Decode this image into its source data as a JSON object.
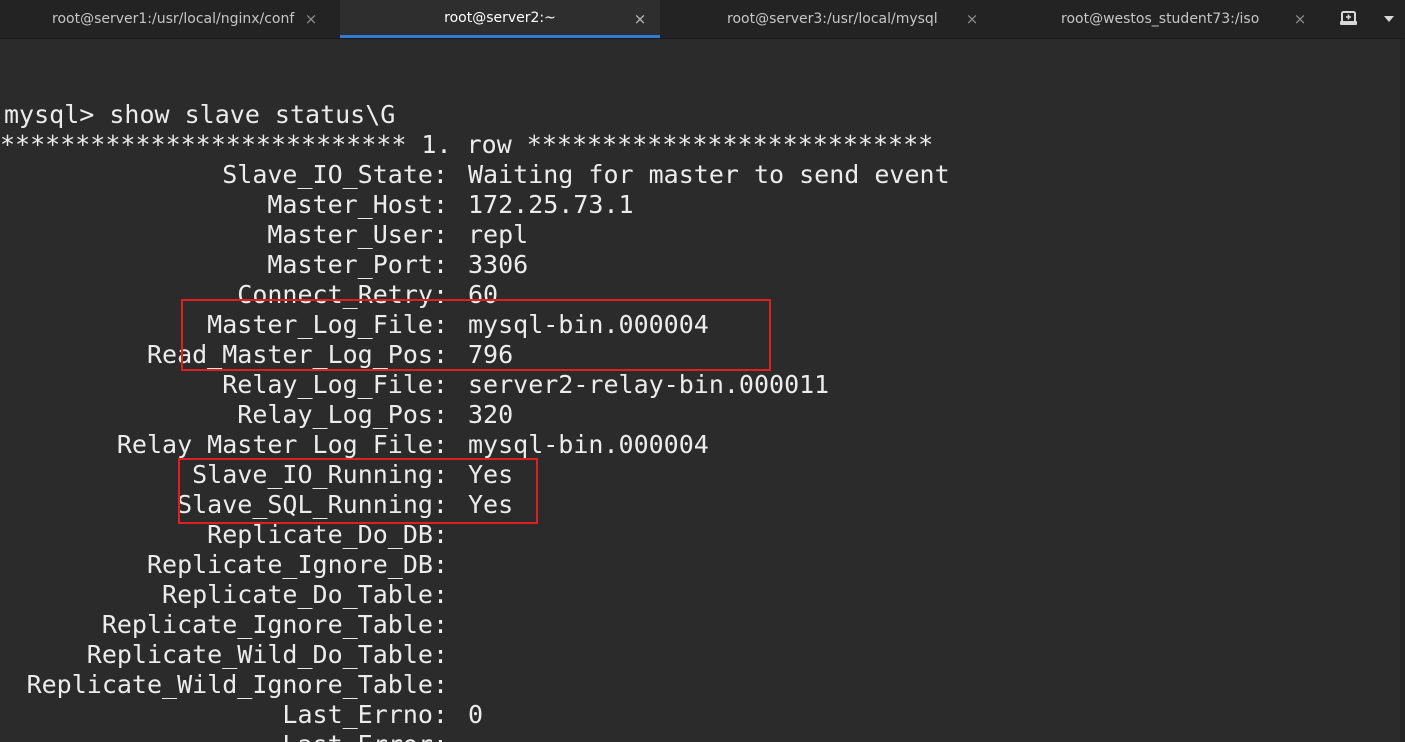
{
  "tabs": [
    {
      "label": "root@server1:/usr/local/nginx/conf",
      "active": false
    },
    {
      "label": "root@server2:~",
      "active": true
    },
    {
      "label": "root@server3:/usr/local/mysql",
      "active": false
    },
    {
      "label": "root@westos_student73:/iso",
      "active": false
    }
  ],
  "icons": {
    "tab_close": "×",
    "new_tab": "terminal-plus-icon",
    "menu": "chevron-down-icon"
  },
  "colors": {
    "background": "#2b2b2b",
    "text": "#ececec",
    "active_tab_underline": "#2f7bd6",
    "highlight_box": "#e0201e"
  },
  "terminal": {
    "prompt_line": "mysql> show slave status\\G",
    "row_header": "*************************** 1. row ***************************",
    "fields": [
      {
        "key": "Slave_IO_State:",
        "value": "Waiting for master to send event"
      },
      {
        "key": "Master_Host:",
        "value": "172.25.73.1"
      },
      {
        "key": "Master_User:",
        "value": "repl"
      },
      {
        "key": "Master_Port:",
        "value": "3306"
      },
      {
        "key": "Connect_Retry:",
        "value": "60"
      },
      {
        "key": "Master_Log_File:",
        "value": "mysql-bin.000004"
      },
      {
        "key": "Read_Master_Log_Pos:",
        "value": "796"
      },
      {
        "key": "Relay_Log_File:",
        "value": "server2-relay-bin.000011"
      },
      {
        "key": "Relay_Log_Pos:",
        "value": "320"
      },
      {
        "key": "Relay_Master_Log_File:",
        "value": "mysql-bin.000004"
      },
      {
        "key": "Slave_IO_Running:",
        "value": "Yes"
      },
      {
        "key": "Slave_SQL_Running:",
        "value": "Yes"
      },
      {
        "key": "Replicate_Do_DB:",
        "value": ""
      },
      {
        "key": "Replicate_Ignore_DB:",
        "value": ""
      },
      {
        "key": "Replicate_Do_Table:",
        "value": ""
      },
      {
        "key": "Replicate_Ignore_Table:",
        "value": ""
      },
      {
        "key": "Replicate_Wild_Do_Table:",
        "value": ""
      },
      {
        "key": "Replicate_Wild_Ignore_Table:",
        "value": ""
      },
      {
        "key": "Last_Errno:",
        "value": "0"
      },
      {
        "key": "Last_Error:",
        "value": ""
      }
    ]
  }
}
